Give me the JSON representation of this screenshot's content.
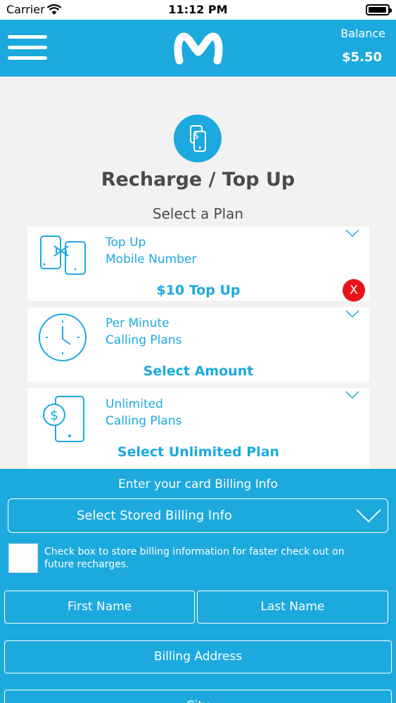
{
  "status_bar": {
    "carrier": "Carrier",
    "time": "11:12 PM",
    "battery_level": 0.95
  },
  "header": {
    "balance_label": "Balance",
    "balance_value": "$5.50",
    "logo_icon": "movistar-m-logo",
    "menu_icon": "hamburger-menu-icon"
  },
  "page": {
    "title": "Recharge / Top Up",
    "subtitle": "Select a Plan",
    "hero_icon": "phone-dollar-icon"
  },
  "plans": [
    {
      "line1": "Top Up",
      "line2": "Mobile Number",
      "action": "$10 Top Up",
      "icon": "phone-transfer-icon"
    },
    {
      "line1": "Per Minute",
      "line2": "Calling Plans",
      "action": "Select Amount",
      "icon": "clock-icon"
    },
    {
      "line1": "Unlimited",
      "line2": "Calling Plans",
      "action": "Select Unlimited Plan",
      "icon": "phone-dollar-icon"
    }
  ],
  "remove_button_label": "X",
  "billing": {
    "title": "Enter your card Billing Info",
    "stored_select_label": "Select Stored Billing Info",
    "store_checkbox_text": "Check box to store billing information for faster check out on future recharges.",
    "first_name_placeholder": "First Name",
    "last_name_placeholder": "Last Name",
    "address_placeholder": "Billing Address",
    "city_placeholder": "City"
  },
  "colors": {
    "brand": "#1ca9de",
    "danger": "#e8121b",
    "heading": "#4a4a4a"
  }
}
